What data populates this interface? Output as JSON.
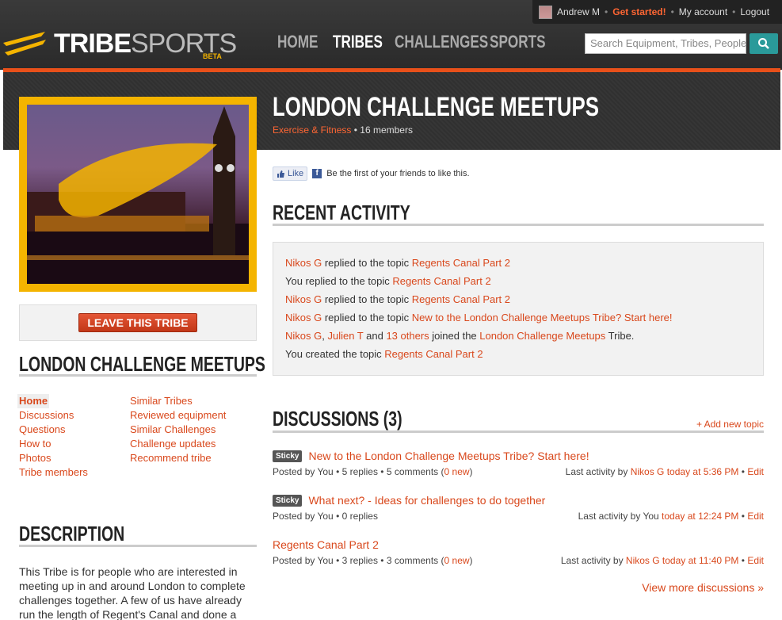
{
  "header": {
    "user_name": "Andrew M",
    "get_started": "Get started!",
    "my_account": "My account",
    "logout": "Logout",
    "logo_tribe": "TRIBE",
    "logo_sports": "SPORTS",
    "logo_beta": "BETA",
    "nav": [
      "HOME",
      "TRIBES",
      "CHALLENGES",
      "SPORTS"
    ],
    "search_placeholder": "Search Equipment, Tribes, People"
  },
  "tribe": {
    "title": "LONDON CHALLENGE MEETUPS",
    "category": "Exercise & Fitness",
    "members": "16 members",
    "leave_label": "LEAVE THIS TRIBE"
  },
  "facebook": {
    "like_label": "Like",
    "text": "Be the first of your friends to like this."
  },
  "sidebar": {
    "title": "LONDON CHALLENGE MEETUPS",
    "left_links": [
      "Home",
      "Discussions",
      "Questions",
      "How to",
      "Photos",
      "Tribe members"
    ],
    "right_links": [
      "Similar Tribes",
      "Reviewed equipment",
      "Similar Challenges",
      "Challenge updates",
      "Recommend tribe"
    ],
    "description_title": "DESCRIPTION",
    "description": "This Tribe is for people who are interested in meeting up in and around London to complete challenges together. A few of us have already run the length of Regent's Canal and done a"
  },
  "recent": {
    "title": "RECENT ACTIVITY",
    "a1": {
      "who": "Nikos G",
      "verb": " replied to the topic ",
      "topic": "Regents Canal Part 2"
    },
    "a2": {
      "who": "You replied to the topic ",
      "topic": "Regents Canal Part 2"
    },
    "a3": {
      "who": "Nikos G",
      "verb": " replied to the topic ",
      "topic": "Regents Canal Part 2"
    },
    "a4": {
      "who": "Nikos G",
      "verb": " replied to the topic ",
      "topic": "New to the London Challenge Meetups Tribe? Start here!"
    },
    "a5": {
      "p1": "Nikos G",
      "c1": ", ",
      "p2": "Julien T",
      "c2": " and ",
      "p3": "13 others",
      "verb": " joined the ",
      "tribe": "London Challenge Meetups",
      "end": " Tribe."
    },
    "a6": {
      "who": "You created the topic ",
      "topic": "Regents Canal Part 2"
    }
  },
  "discussions": {
    "title": "DISCUSSIONS (3)",
    "add_label": "+ Add new topic",
    "sticky_label": "Sticky",
    "t1": {
      "title": "New to the London Challenge Meetups Tribe? Start here!",
      "meta": "Posted by You • 5 replies • 5 comments (",
      "new": "0 new",
      "close": ")",
      "last": "Last activity by ",
      "by": "Nikos G",
      "when": " today at 5:36 PM",
      "sep": " • ",
      "edit": "Edit"
    },
    "t2": {
      "title": "What next? - Ideas for challenges to do together",
      "meta": "Posted by You • 0 replies",
      "last": "Last activity by You ",
      "when": "today at 12:24 PM",
      "sep": " • ",
      "edit": "Edit"
    },
    "t3": {
      "title": "Regents Canal Part 2",
      "meta": "Posted by You • 3 replies • 3 comments (",
      "new": "0 new",
      "close": ")",
      "last": "Last activity by ",
      "by": "Nikos G",
      "when": " today at 11:40 PM",
      "sep": " • ",
      "edit": "Edit"
    },
    "view_more": "View more discussions »"
  },
  "colors": {
    "accent": "#d9481c",
    "frame": "#f4b400",
    "search_button": "#2a9a9a"
  }
}
